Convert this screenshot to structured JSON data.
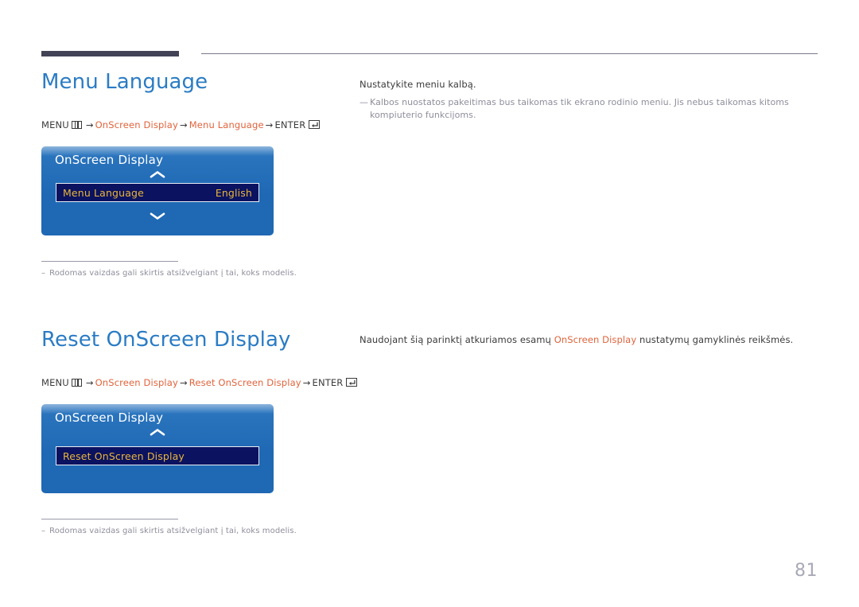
{
  "page": {
    "number": "81"
  },
  "sections": [
    {
      "heading": "Menu Language",
      "breadcrumb": {
        "menu_label": "MENU",
        "menu_icon": "menu-grid-icon",
        "arrow": "→",
        "crumb1": "OnScreen Display",
        "crumb2": "Menu Language",
        "enter_label": "ENTER",
        "enter_icon": "enter-key-icon"
      },
      "osd": {
        "title": "OnScreen Display",
        "chevron_up": "chevron-up-icon",
        "chevron_down": "chevron-down-icon",
        "row_label": "Menu Language",
        "row_value": "English"
      },
      "footnote": {
        "dash": "–",
        "text": "Rodomas vaizdas gali skirtis atsižvelgiant į tai, koks modelis."
      },
      "right": {
        "lead": "Nustatykite meniu kalbą.",
        "note_dash": "—",
        "note": "Kalbos nuostatos pakeitimas bus taikomas tik ekrano rodinio meniu. Jis nebus taikomas kitoms kompiuterio funkcijoms."
      }
    },
    {
      "heading": "Reset OnScreen Display",
      "breadcrumb": {
        "menu_label": "MENU",
        "menu_icon": "menu-grid-icon",
        "arrow": "→",
        "crumb1": "OnScreen Display",
        "crumb2": "Reset OnScreen Display",
        "enter_label": "ENTER",
        "enter_icon": "enter-key-icon"
      },
      "osd": {
        "title": "OnScreen Display",
        "chevron_up": "chevron-up-icon",
        "row_label": "Reset OnScreen Display",
        "row_value": ""
      },
      "footnote": {
        "dash": "–",
        "text": "Rodomas vaizdas gali skirtis atsižvelgiant į tai, koks modelis."
      },
      "right": {
        "lead_part1": "Naudojant šią parinktį atkuriamos esamų ",
        "lead_highlight": "OnScreen Display",
        "lead_part2": " nustatymų gamyklinės reikšmės."
      }
    }
  ],
  "colors": {
    "heading_blue": "#2b7cc4",
    "breadcrumb_orange": "#e0643c",
    "osd_blue": "#1f68b4",
    "osd_row_navy": "#0b1260",
    "osd_row_gold": "#e8b63c",
    "rule_dark": "#434356",
    "muted_gray": "#8e8e9c"
  }
}
